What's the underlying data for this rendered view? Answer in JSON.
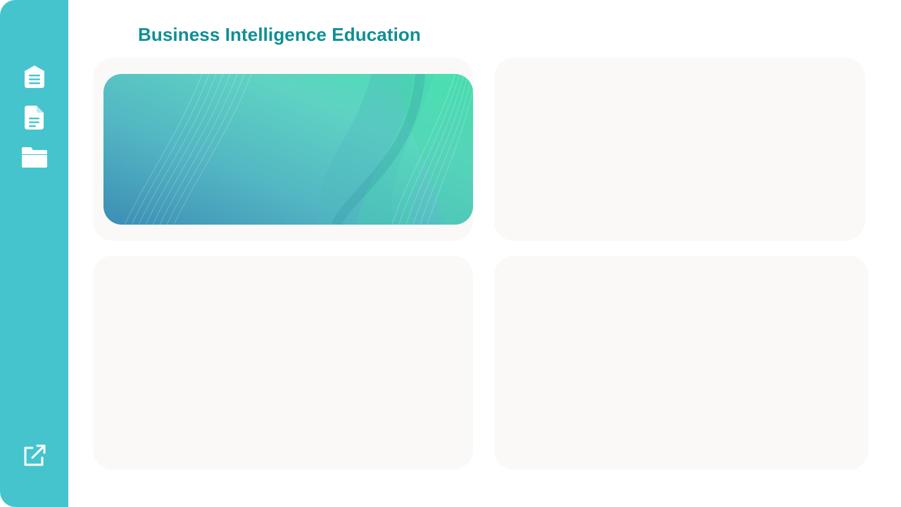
{
  "page": {
    "title": "Business Intelligence Education"
  },
  "sidebar": {
    "items": [
      {
        "icon": "library-icon"
      },
      {
        "icon": "document-icon"
      },
      {
        "icon": "folder-icon"
      }
    ],
    "footer_icon": "external-link-icon"
  },
  "colors": {
    "sidebar": "#45c4cd",
    "title": "#0f8f94",
    "card": "#faf9f7",
    "banner_start": "#3c8db5",
    "banner_end": "#48e0b0"
  }
}
